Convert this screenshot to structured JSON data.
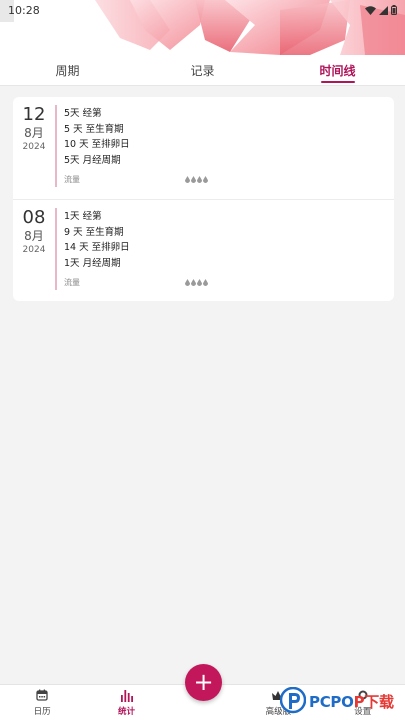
{
  "status_bar": {
    "time": "10:28"
  },
  "tabs": [
    {
      "label": "周期",
      "active": false
    },
    {
      "label": "记录",
      "active": false
    },
    {
      "label": "时间线",
      "active": true
    }
  ],
  "entries": [
    {
      "day": "12",
      "month": "8月",
      "year": "2024",
      "lines": [
        "5天 经第",
        "5 天 至生育期",
        "10 天 至排卵日",
        "5天 月经周期"
      ],
      "flow_label": "流量"
    },
    {
      "day": "08",
      "month": "8月",
      "year": "2024",
      "lines": [
        "1天 经第",
        "9 天 至生育期",
        "14 天 至排卵日",
        "1天 月经周期"
      ],
      "flow_label": "流量"
    }
  ],
  "bottom_nav": [
    {
      "label": "日历",
      "icon": "calendar-icon",
      "active": false
    },
    {
      "label": "统计",
      "icon": "bar-chart-icon",
      "active": true
    },
    {
      "label": "高级版",
      "icon": "crown-icon",
      "active": false
    },
    {
      "label": "设置",
      "icon": "gear-icon",
      "active": false
    }
  ],
  "fab": {
    "icon": "plus-icon",
    "label": "+"
  },
  "watermark": {
    "text_blue": "PCPO",
    "text_red": "P下载"
  },
  "colors": {
    "accent": "#b0155a",
    "fab": "#c2185b",
    "divider": "#e8b8c8"
  }
}
